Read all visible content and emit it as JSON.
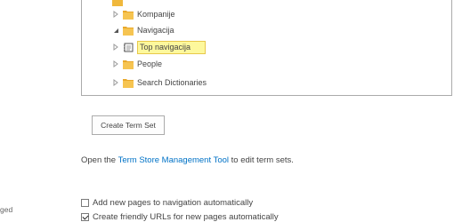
{
  "term_tree": {
    "items": [
      {
        "label": "Kompanije",
        "expanded": false,
        "icon": "folder-icon"
      },
      {
        "label": "Navigacija",
        "expanded": true,
        "icon": "folder-icon"
      },
      {
        "label": "Top navigacija",
        "selected": true,
        "icon": "term-set-icon"
      },
      {
        "label": "People",
        "expanded": false,
        "icon": "folder-icon"
      },
      {
        "label": "Search Dictionaries",
        "expanded": false,
        "icon": "folder-icon"
      }
    ]
  },
  "create_term_set_label": "Create Term Set",
  "info": {
    "prefix": "Open the ",
    "link": "Term Store Management Tool",
    "suffix": " to edit term sets."
  },
  "options": [
    {
      "label": "Add new pages to navigation automatically",
      "checked": false
    },
    {
      "label": "Create friendly URLs for new pages automatically",
      "checked": true
    }
  ],
  "side_fragment": "ged",
  "colors": {
    "link": "#0072c6",
    "selection_bg": "#fdf89d",
    "folder": "#f0b83c"
  }
}
